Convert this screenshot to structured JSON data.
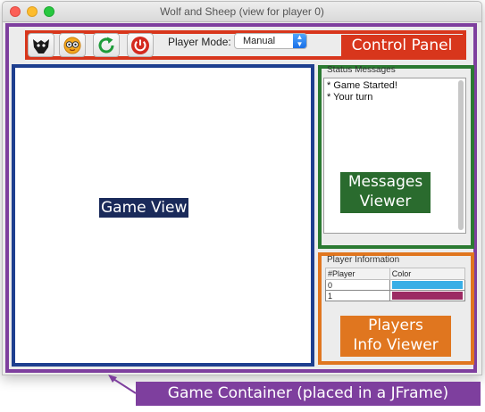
{
  "window": {
    "title": "Wolf and Sheep (view for player 0)"
  },
  "toolbar": {
    "buttons": [
      {
        "name": "wolf-icon"
      },
      {
        "name": "sheep-icon"
      },
      {
        "name": "restart-icon"
      },
      {
        "name": "power-icon"
      }
    ],
    "player_mode_label": "Player Mode:",
    "player_mode_value": "Manual"
  },
  "labels": {
    "control_panel": "Control Panel",
    "game_view": "Game View",
    "messages_viewer_line1": "Messages",
    "messages_viewer_line2": "Viewer",
    "players_info_line1": "Players",
    "players_info_line2": "Info Viewer",
    "game_container": "Game Container (placed in a JFrame)"
  },
  "messages": {
    "title": "Status Messages",
    "items": [
      "* Game Started!",
      "* Your turn"
    ]
  },
  "player_info": {
    "title": "Player Information",
    "columns": [
      "#Player",
      "Color"
    ],
    "rows": [
      {
        "player": "0",
        "color": "#39aee6"
      },
      {
        "player": "1",
        "color": "#9c2a63"
      }
    ]
  },
  "colors": {
    "container": "#7e3f9e",
    "control_panel": "#d8361c",
    "game_view": "#1e3f8f",
    "messages_viewer": "#2b7a32",
    "players_info": "#e0761f"
  }
}
